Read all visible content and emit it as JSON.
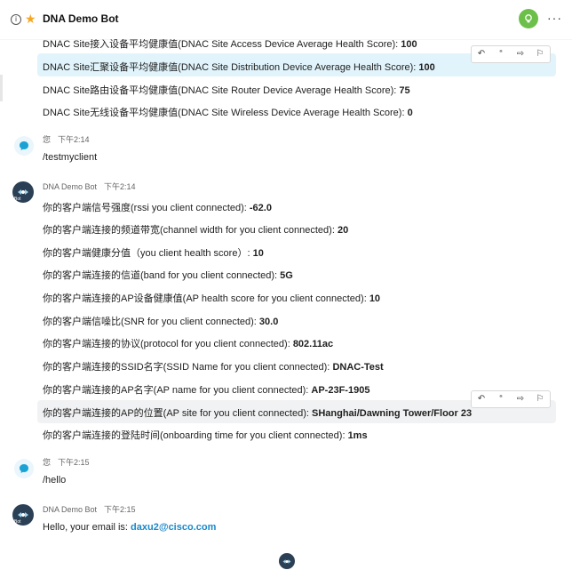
{
  "header": {
    "info_icon": "info-icon",
    "star_icon": "star-icon",
    "title": "DNA Demo Bot",
    "more": "···"
  },
  "messages_top": [
    {
      "prefix": "DNAC Site接入设备平均健康值(DNAC Site Access Device Average Health Score): ",
      "value": "100"
    },
    {
      "prefix": "DNAC Site汇聚设备平均健康值(DNAC Site Distribution Device Average Health Score): ",
      "value": "100"
    },
    {
      "prefix": "DNAC Site路由设备平均健康值(DNAC Site Router Device Average Health Score): ",
      "value": "75"
    },
    {
      "prefix": "DNAC Site无线设备平均健康值(DNAC Site Wireless Device Average Health Score): ",
      "value": "0"
    }
  ],
  "you1": {
    "sender": "您",
    "time": "下午2:14",
    "text": "/testmyclient"
  },
  "bot1": {
    "sender": "DNA Demo Bot",
    "time": "下午2:14",
    "avatar_tag": "Bot"
  },
  "client_lines": [
    {
      "prefix": "你的客户端信号强度(rssi you client connected): ",
      "value": "-62.0"
    },
    {
      "prefix": "你的客户端连接的频道带宽(channel width for you client connected): ",
      "value": "20"
    },
    {
      "prefix": "你的客户端健康分值（you client health score）: ",
      "value": "10"
    },
    {
      "prefix": "你的客户端连接的信道(band for you client connected): ",
      "value": "5G"
    },
    {
      "prefix": "你的客户端连接的AP设备健康值(AP health score for you client connected): ",
      "value": "10"
    },
    {
      "prefix": "你的客户端信噪比(SNR for you client connected): ",
      "value": "30.0"
    },
    {
      "prefix": "你的客户端连接的协议(protocol for you client connected): ",
      "value": "802.11ac"
    },
    {
      "prefix": "你的客户端连接的SSID名字(SSID Name for you client connected): ",
      "value": "DNAC-Test"
    },
    {
      "prefix": "你的客户端连接的AP名字(AP name for you client connected): ",
      "value": "AP-23F-1905"
    },
    {
      "prefix": "你的客户端连接的AP的位置(AP site for you client connected): ",
      "value": "SHanghai/Dawning Tower/Floor 23"
    },
    {
      "prefix": "你的客户端连接的登陆时间(onboarding time for you client connected): ",
      "value": "1ms"
    }
  ],
  "you2": {
    "sender": "您",
    "time": "下午2:15",
    "text": "/hello"
  },
  "bot2": {
    "sender": "DNA Demo Bot",
    "time": "下午2:15",
    "avatar_tag": "Bot",
    "text_prefix": "Hello, your email is: ",
    "email": "daxu2@cisco.com"
  },
  "msg_actions": {
    "reply": "↶",
    "quote": "“",
    "forward": "⇨",
    "flag": "⚐"
  },
  "colors": {
    "accent": "#1a88c9",
    "highlight_blue": "#e1f4fb",
    "highlight_grey": "#f1f2f3",
    "green": "#6cc04a",
    "star": "#f5a623"
  }
}
